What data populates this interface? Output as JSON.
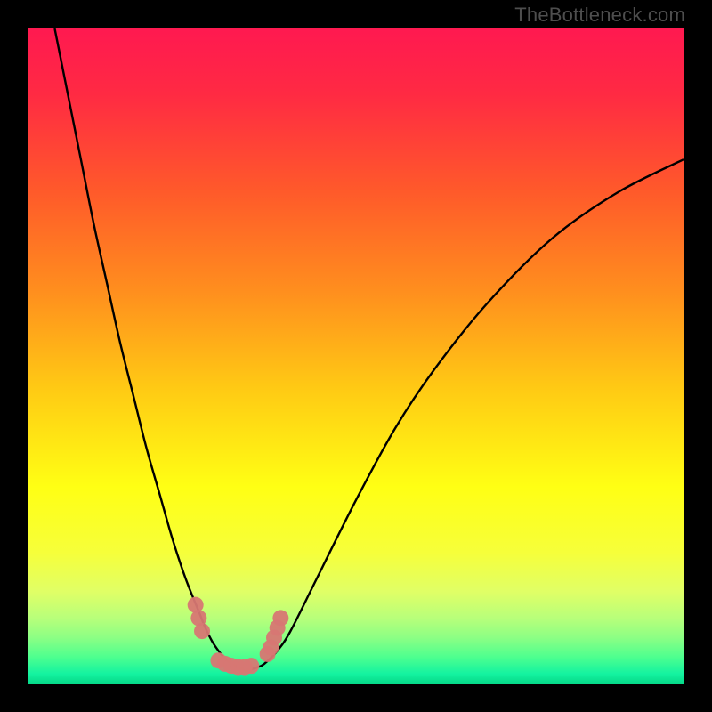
{
  "attribution": "TheBottleneck.com",
  "colors": {
    "background": "#000000",
    "gradient_stops": [
      {
        "pos": 0.0,
        "color": "#ff1950"
      },
      {
        "pos": 0.1,
        "color": "#ff2a43"
      },
      {
        "pos": 0.25,
        "color": "#ff5a2a"
      },
      {
        "pos": 0.4,
        "color": "#ff8e1e"
      },
      {
        "pos": 0.55,
        "color": "#ffca14"
      },
      {
        "pos": 0.7,
        "color": "#ffff14"
      },
      {
        "pos": 0.8,
        "color": "#f6ff3a"
      },
      {
        "pos": 0.86,
        "color": "#e0ff66"
      },
      {
        "pos": 0.9,
        "color": "#b8ff7a"
      },
      {
        "pos": 0.93,
        "color": "#8cff84"
      },
      {
        "pos": 0.96,
        "color": "#4dff8f"
      },
      {
        "pos": 0.985,
        "color": "#14f3a0"
      },
      {
        "pos": 1.0,
        "color": "#06d989"
      }
    ],
    "curve_stroke": "#000000",
    "marker_fill": "#d77773"
  },
  "chart_data": {
    "type": "line",
    "title": "",
    "xlabel": "",
    "ylabel": "",
    "xlim": [
      0,
      100
    ],
    "ylim": [
      0,
      100
    ],
    "series": [
      {
        "name": "bottleneck-curve",
        "x": [
          4,
          6,
          8,
          10,
          12,
          14,
          16,
          18,
          20,
          22,
          24,
          26,
          27,
          28,
          29,
          30,
          31,
          32,
          33,
          34,
          35,
          36,
          38,
          40,
          44,
          50,
          56,
          62,
          70,
          80,
          90,
          100
        ],
        "y": [
          100,
          90,
          80,
          70,
          61,
          52,
          44,
          36,
          29,
          22,
          16,
          11,
          8.5,
          6.5,
          5,
          3.8,
          3,
          2.5,
          2.2,
          2.2,
          2.5,
          3,
          5,
          8,
          16,
          28,
          39,
          48,
          58,
          68,
          75,
          80
        ]
      }
    ],
    "markers": [
      {
        "x": 25.5,
        "y": 12
      },
      {
        "x": 26.0,
        "y": 10
      },
      {
        "x": 26.5,
        "y": 8
      },
      {
        "x": 29.0,
        "y": 3.5
      },
      {
        "x": 30.0,
        "y": 3.0
      },
      {
        "x": 31.0,
        "y": 2.7
      },
      {
        "x": 32.0,
        "y": 2.5
      },
      {
        "x": 33.0,
        "y": 2.5
      },
      {
        "x": 34.0,
        "y": 2.7
      },
      {
        "x": 36.5,
        "y": 4.5
      },
      {
        "x": 37.0,
        "y": 5.5
      },
      {
        "x": 37.5,
        "y": 7.0
      },
      {
        "x": 38.0,
        "y": 8.5
      },
      {
        "x": 38.5,
        "y": 10.0
      }
    ],
    "marker_radius_px": 9
  }
}
